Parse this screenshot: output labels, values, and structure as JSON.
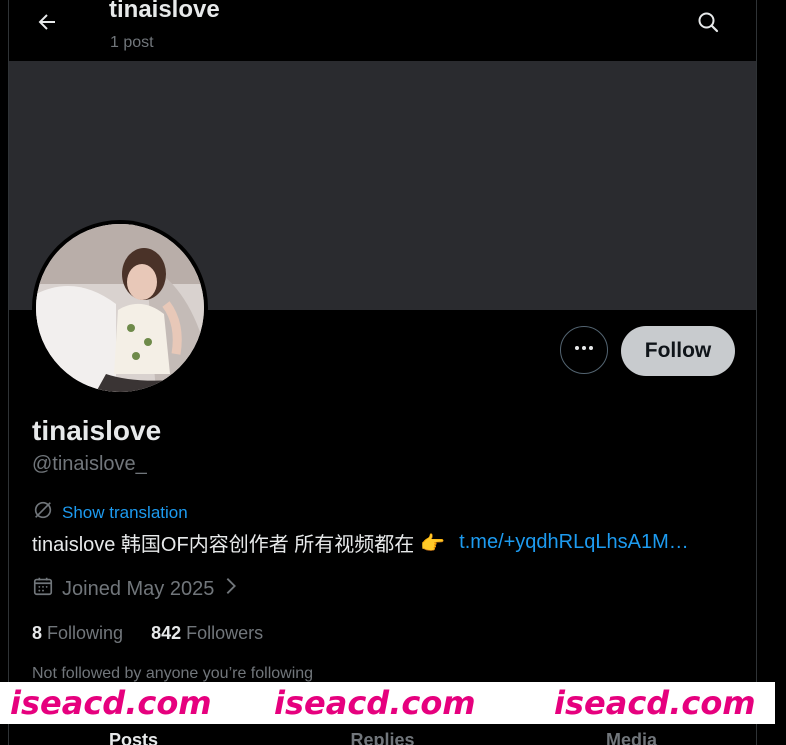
{
  "header": {
    "title": "tinaislove",
    "post_count": "1 post"
  },
  "profile": {
    "display_name": "tinaislove",
    "handle": "@tinaislove_",
    "translation_label": "Show translation",
    "bio_text": "tinaislove 韩国OF内容创作者 所有视频都在",
    "bio_emoji": "👉",
    "bio_link": "t.me/+yqdhRLqLhsA1M…",
    "joined": "Joined May 2025",
    "following_count": "8",
    "following_label": "Following",
    "followers_count": "842",
    "followers_label": "Followers",
    "not_followed_text": "Not followed by anyone you’re following"
  },
  "actions": {
    "follow_label": "Follow"
  },
  "tabs": [
    {
      "label": "Posts"
    },
    {
      "label": "Replies"
    },
    {
      "label": "Media"
    }
  ],
  "watermark": {
    "text": [
      "iseacd.com",
      "iseacd.com",
      "iseacd.com"
    ]
  },
  "colors": {
    "background": "#000000",
    "banner": "#2a2b2f",
    "link": "#1d9bf0",
    "muted": "#71767b",
    "follow_button": "#c8cbce",
    "watermark": "#e6007e"
  }
}
